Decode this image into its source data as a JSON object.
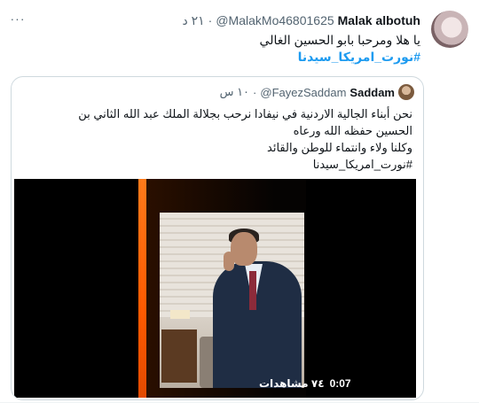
{
  "tweet": {
    "name": "Malak albotuh",
    "handle": "@MalakMo46801625",
    "time": "٢١ د",
    "dot": "·",
    "more": "···",
    "text": "يا هلا ومرحبا بابو الحسين الغالي",
    "hashtag": "#نورت_امريكا_سيدنا"
  },
  "quote": {
    "name": "Saddam",
    "handle": "@FayezSaddam",
    "time": "١٠ س",
    "dot": "·",
    "lines": [
      "نحن أبناء الجالية الاردنية في نيفادا نرحب بجلالة الملك عبد الله الثاني بن",
      "الحسين حفظه الله ورعاه",
      "وكلنا ولاء وانتماء للوطن والقائد",
      "#نورت_امريكا_سيدنا"
    ]
  },
  "video": {
    "duration": "0:07",
    "views": "٧٤ مشاهدات"
  }
}
